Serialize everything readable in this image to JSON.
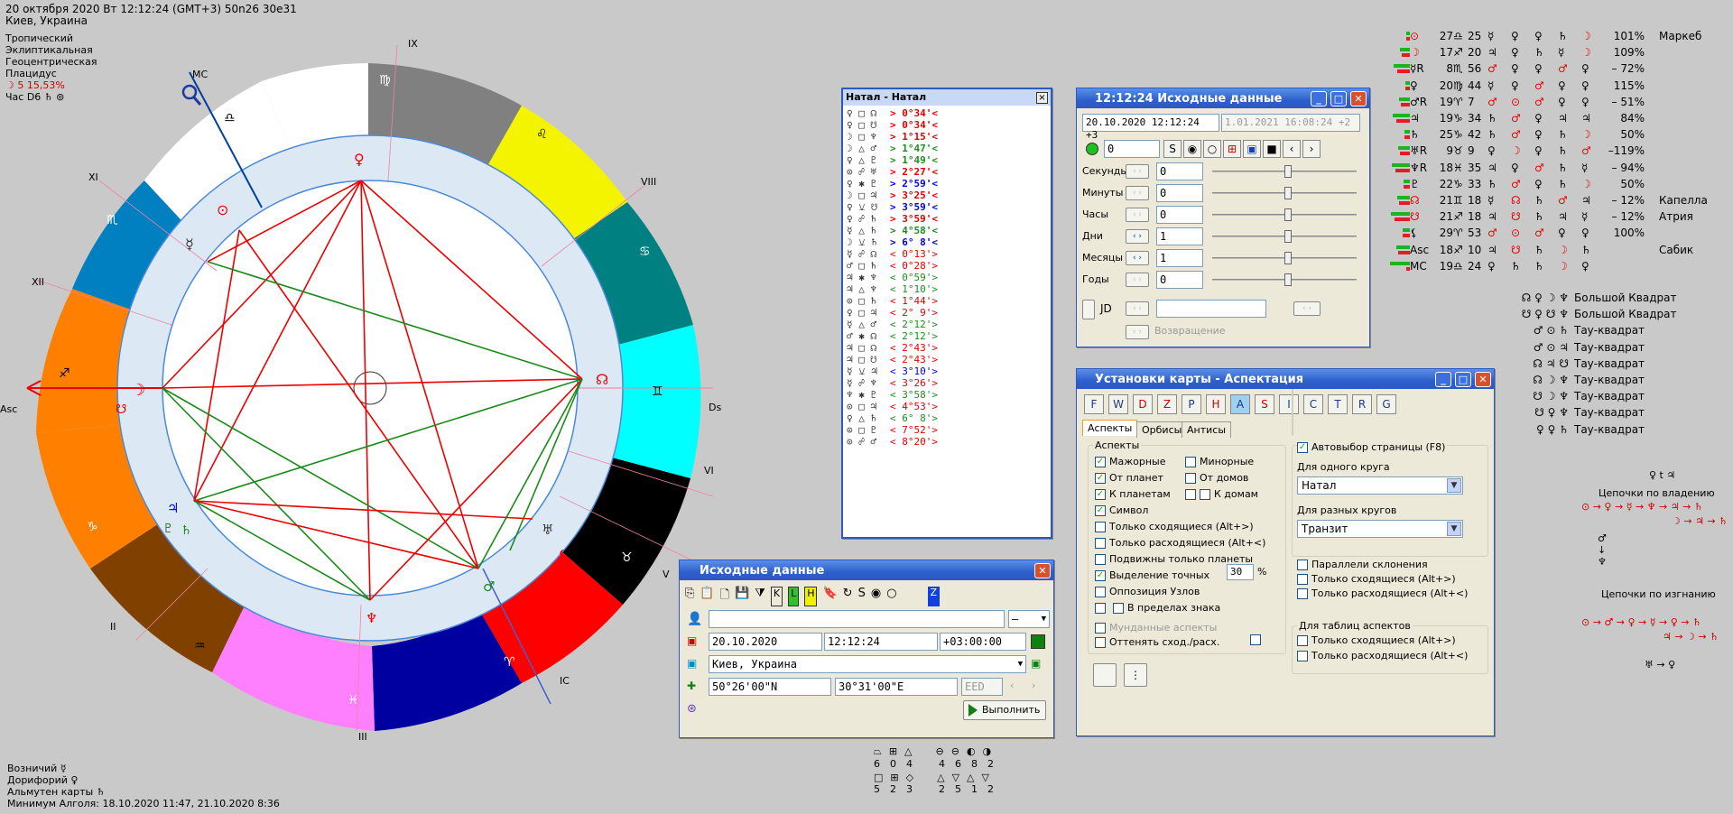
{
  "header": {
    "line1": "20 октября 2020   Вт   12:12:24 (GMT+3) 50n26  30e31",
    "line2": "Киев, Украина"
  },
  "settings_info": [
    "Тропический",
    "Эклиптикальная",
    "Геоцентрическая",
    "Плацидус"
  ],
  "moon_info": "☽   5 15,53%",
  "hour_info": "Час D6  ♄  ⊚",
  "chart_labels": {
    "asc": "Asc",
    "dsc": "Dsc",
    "mc": "MC",
    "ic": "IC",
    "houses": [
      "XII",
      "XI",
      "IX",
      "VIII",
      "VI",
      "V",
      "III",
      "II"
    ],
    "signs": [
      "♍",
      "♌",
      "♋",
      "♊",
      "♉",
      "♈",
      "♓",
      "♒",
      "♑",
      "♐",
      "♏",
      "♎"
    ]
  },
  "footer": {
    "line1": "Возничий  ☿",
    "line2": "Дорифорий  ♀",
    "line3": "Альмутен карты  ♄",
    "line4": "Минимум Алголя: 18.10.2020 11:47,  21.10.2020  8:36"
  },
  "natal_window": {
    "title": "Натал - Натал",
    "aspects": [
      {
        "g": "♀ □ ☊",
        "v": "> 0°34'<",
        "c": "#e00000"
      },
      {
        "g": "♀ □ ☋",
        "v": "> 0°34'<",
        "c": "#e00000"
      },
      {
        "g": "☽ □ ♆",
        "v": "> 1°15'<",
        "c": "#e00000"
      },
      {
        "g": "☽ △ ♂",
        "v": "> 1°47'<",
        "c": "#1a8f1a"
      },
      {
        "g": "♀ △ ♇",
        "v": "> 1°49'<",
        "c": "#1a8f1a"
      },
      {
        "g": "⊙ ☍ ♅",
        "v": "> 2°27'<",
        "c": "#e00000"
      },
      {
        "g": "♀ ✱ ♇",
        "v": "> 2°59'<",
        "c": "#0000e0"
      },
      {
        "g": "☽ □ ♃",
        "v": "> 3°25'<",
        "c": "#e00000"
      },
      {
        "g": "♀ ⚺ ☋",
        "v": "> 3°59'<",
        "c": "#0000e0"
      },
      {
        "g": "♀ ☍ ♄",
        "v": "> 3°59'<",
        "c": "#e00000"
      },
      {
        "g": "☿ △ ♄",
        "v": "> 4°58'<",
        "c": "#1a8f1a"
      },
      {
        "g": "☽ ⚺ ♄",
        "v": "> 6° 8'<",
        "c": "#0000e0"
      },
      {
        "g": "☿ ☍ ☊",
        "v": "<  0°13'>",
        "c": "#e00000"
      },
      {
        "g": "♂ □ ♄",
        "v": "<  0°28'>",
        "c": "#e00000"
      },
      {
        "g": "♃ ✱ ♆",
        "v": "<  0°59'>",
        "c": "#1a8f1a"
      },
      {
        "g": "♃ △ ♆",
        "v": "<  1°10'>",
        "c": "#1a8f1a"
      },
      {
        "g": "⊙ □ ♄",
        "v": "<  1°44'>",
        "c": "#e00000"
      },
      {
        "g": "♀ □ ♃",
        "v": "<  2° 9'>",
        "c": "#e00000"
      },
      {
        "g": "☿ △ ♂",
        "v": "<  2°12'>",
        "c": "#1a8f1a"
      },
      {
        "g": "♂ ✱ ☊",
        "v": "<  2°12'>",
        "c": "#1a8f1a"
      },
      {
        "g": "♃ □ ☊",
        "v": "<  2°43'>",
        "c": "#e00000"
      },
      {
        "g": "♃ □ ☋",
        "v": "<  2°43'>",
        "c": "#e00000"
      },
      {
        "g": "☿ ⚺ ♃",
        "v": "<  3°10'>",
        "c": "#0000e0"
      },
      {
        "g": "☿ ☍ ♆",
        "v": "<  3°26'>",
        "c": "#e00000"
      },
      {
        "g": "♆ ✱ ♇",
        "v": "<  3°58'>",
        "c": "#1a8f1a"
      },
      {
        "g": "⊙ □ ♃",
        "v": "<  4°53'>",
        "c": "#e00000"
      },
      {
        "g": "♀ △ ♄",
        "v": "<  6° 8'>",
        "c": "#1a8f1a"
      },
      {
        "g": "⊙ □ ♇",
        "v": "<  7°52'>",
        "c": "#e00000"
      },
      {
        "g": "⊙ ☍ ♂",
        "v": "<  8°20'>",
        "c": "#e00000"
      }
    ]
  },
  "source_window": {
    "title": "Исходные данные",
    "name_value": "",
    "date": "20.10.2020",
    "time": "12:12:24",
    "tz": "+03:00:00",
    "place": "Киев, Украина",
    "lat": "50°26'00\"N",
    "lon": "30°31'00\"E",
    "eed_placeholder": "EED",
    "run_label": "Выполнить",
    "dash": "–"
  },
  "time_window": {
    "title": "12:12:24 Исходные данные",
    "datetime1": "20.10.2020  12:12:24  +3",
    "datetime2": "1.01.2021  16:08:24  +2",
    "counter": "0",
    "rows": [
      {
        "label": "Секунды",
        "value": "0"
      },
      {
        "label": "Минуты",
        "value": "0"
      },
      {
        "label": "Часы",
        "value": "0"
      },
      {
        "label": "Дни",
        "value": "1"
      },
      {
        "label": "Месяцы",
        "value": "1"
      },
      {
        "label": "Годы",
        "value": "0"
      }
    ],
    "jd_label": "JD",
    "return_label": "Возвращение"
  },
  "settings_window": {
    "title": "Установки карты - Аспектация",
    "tabs": [
      "Аспекты",
      "Орбисы",
      "Антисы"
    ],
    "toolbar_letters": [
      "F",
      "W",
      "D",
      "Z",
      "P",
      "H",
      "A",
      "S",
      "I",
      "C",
      "T",
      "R",
      "G"
    ],
    "aspects_group": "Аспекты",
    "checks": [
      {
        "label": "Мажорные",
        "on": true
      },
      {
        "label": "От планет",
        "on": true
      },
      {
        "label": "К планетам",
        "on": true
      },
      {
        "label": "Символ",
        "on": true
      },
      {
        "label": "Только сходящиеся  (Alt+>)",
        "on": false
      },
      {
        "label": "Только расходящиеся (Alt+<)",
        "on": false
      },
      {
        "label": "Подвижны только планеты",
        "on": false
      },
      {
        "label": "Выделение точных",
        "on": true
      },
      {
        "label": "Оппозиция Узлов",
        "on": false
      },
      {
        "label": "В пределах знака",
        "on": false
      },
      {
        "label": "Мунданные аспекты",
        "on": false
      },
      {
        "label": "Оттенять сход./расх.",
        "on": false
      }
    ],
    "minor": "Минорные",
    "from_houses": "От домов",
    "to_houses": "К домам",
    "exact_value": "30",
    "percent": "%",
    "autopage": "Автовыбор страницы  (F8)",
    "one_circle": "Для одного круга",
    "one_circle_value": "Натал",
    "diff_circles": "Для разных кругов",
    "diff_circles_value": "Транзит",
    "parallels": "Параллели склонения",
    "only_conv": "Только сходящиеся  (Alt+>)",
    "only_div": "Только расходящиеся (Alt+<)",
    "tables_group": "Для таблиц аспектов",
    "only_conv2": "Только сходящиеся  (Alt+>)",
    "only_div2": "Только расходящиеся (Alt+<)"
  },
  "right_table": [
    {
      "p": "⊙",
      "d": "27",
      "s": "♎",
      "m": "25",
      "r1": "☿",
      "r2": "♀",
      "r3": "♀",
      "r4": "♄",
      "r5": "☽",
      "pct": "101%",
      "star": "Маркеб"
    },
    {
      "p": "☽",
      "d": "17",
      "s": "♐",
      "m": "20",
      "r1": "♃",
      "r2": "♀",
      "r3": "♄",
      "r4": "☿",
      "r5": "☽",
      "pct": "109%",
      "star": ""
    },
    {
      "p": "☿R",
      "d": "8",
      "s": "♏",
      "m": "56",
      "r1": "♂",
      "r2": "♀",
      "r3": "♀",
      "r4": "♂",
      "r5": "♀",
      "pct": "– 72%",
      "star": ""
    },
    {
      "p": "♀",
      "d": "20",
      "s": "♍",
      "m": "44",
      "r1": "☿",
      "r2": "♀",
      "r3": "♂",
      "r4": "♀",
      "r5": "♀",
      "pct": "115%",
      "star": ""
    },
    {
      "p": "♂R",
      "d": "19",
      "s": "♈",
      "m": "7",
      "r1": "♂",
      "r2": "⊙",
      "r3": "♂",
      "r4": "♀",
      "r5": "♀",
      "pct": "– 51%",
      "star": ""
    },
    {
      "p": "♃",
      "d": "19",
      "s": "♑",
      "m": "34",
      "r1": "♄",
      "r2": "♂",
      "r3": "♀",
      "r4": "♃",
      "r5": "♃",
      "pct": "84%",
      "star": ""
    },
    {
      "p": "♄",
      "d": "25",
      "s": "♑",
      "m": "42",
      "r1": "♄",
      "r2": "♂",
      "r3": "♀",
      "r4": "♄",
      "r5": "☽",
      "pct": "50%",
      "star": ""
    },
    {
      "p": "♅R",
      "d": "9",
      "s": "♉",
      "m": "9",
      "r1": "♀",
      "r2": "☽",
      "r3": "♀",
      "r4": "♄",
      "r5": "♂",
      "pct": "–119%",
      "star": ""
    },
    {
      "p": "♆R",
      "d": "18",
      "s": "♓",
      "m": "35",
      "r1": "♃",
      "r2": "♀",
      "r3": "♂",
      "r4": "♄",
      "r5": "☿",
      "pct": "– 94%",
      "star": ""
    },
    {
      "p": "♇",
      "d": "22",
      "s": "♑",
      "m": "33",
      "r1": "♄",
      "r2": "♂",
      "r3": "♀",
      "r4": "♄",
      "r5": "☽",
      "pct": "50%",
      "star": ""
    },
    {
      "p": "☊",
      "d": "21",
      "s": "♊",
      "m": "18",
      "r1": "☿",
      "r2": "☊",
      "r3": "♄",
      "r4": "♂",
      "r5": "♃",
      "pct": "– 12%",
      "star": "Капелла"
    },
    {
      "p": "☋",
      "d": "21",
      "s": "♐",
      "m": "18",
      "r1": "♃",
      "r2": "☋",
      "r3": "♄",
      "r4": "♃",
      "r5": "☿",
      "pct": "– 12%",
      "star": "Атрия"
    },
    {
      "p": "⚸",
      "d": "29",
      "s": "♈",
      "m": "53",
      "r1": "♂",
      "r2": "⊙",
      "r3": "♂",
      "r4": "♀",
      "r5": "♀",
      "pct": "100%",
      "star": ""
    },
    {
      "p": "Asc",
      "d": "18",
      "s": "♐",
      "m": "10",
      "r1": "♃",
      "r2": "☋",
      "r3": "♄",
      "r4": "☽",
      "r5": "♄",
      "pct": "",
      "star": "Сабик"
    },
    {
      "p": "MC",
      "d": "19",
      "s": "♎",
      "m": "24",
      "r1": "♀",
      "r2": "♄",
      "r3": "♄",
      "r4": "☽",
      "r5": "♀",
      "pct": "",
      "star": ""
    }
  ],
  "configurations": [
    {
      "g": "☊ ♀ ☽ ♆",
      "name": "Большой Квадрат"
    },
    {
      "g": "☋ ♀ ☋ ♆",
      "name": "Большой Квадрат"
    },
    {
      "g": "♂ ⊙ ♄",
      "name": "Тау-квадрат"
    },
    {
      "g": "♂ ⊙ ♃",
      "name": "Тау-квадрат"
    },
    {
      "g": "☊ ♃ ☋",
      "name": "Тау-квадрат"
    },
    {
      "g": "☊ ☽ ♆",
      "name": "Тау-квадрат"
    },
    {
      "g": "☋ ☽ ♆",
      "name": "Тау-квадрат"
    },
    {
      "g": "☋ ♀ ♆",
      "name": "Тау-квадрат"
    },
    {
      "g": "♀ ♀ ♄",
      "name": "Тау-квадрат"
    }
  ],
  "chains": {
    "rulership_title": "Цепочки по владению",
    "rulership_top": "♀ t ♃",
    "rulership_line1": "⊙ → ♀ → ☿ → ♆ → ♃ → ♄",
    "rulership_line2": "☽ → ♃ → ♄",
    "exile_title": "Цепочки по изгнанию",
    "exile_line1": "⊙ → ♂ → ♀ → ☿ → ♀ → ♄",
    "exile_line2": "♃ → ☽ → ♄",
    "exile_line3": "♅ → ♀"
  },
  "bottom_icons": {
    "row1": [
      "6",
      "0",
      "4",
      "4",
      "6",
      "8",
      "2"
    ],
    "row2": [
      "5",
      "2",
      "3",
      "2",
      "5",
      "1",
      "2"
    ]
  }
}
